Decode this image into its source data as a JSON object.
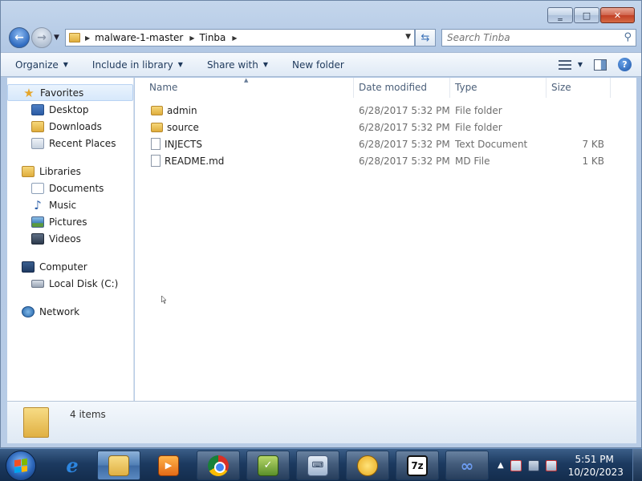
{
  "window": {
    "minimize_glyph": "‗",
    "maximize_glyph": "□",
    "close_glyph": "✕"
  },
  "address": {
    "breadcrumbs": [
      "malware-1-master",
      "Tinba"
    ],
    "back_glyph": "←",
    "forward_glyph": "→"
  },
  "search": {
    "placeholder": "Search Tinba"
  },
  "toolbar": {
    "organize": "Organize",
    "include_in_library": "Include in library",
    "share_with": "Share with",
    "new_folder": "New folder"
  },
  "sidebar": {
    "favorites": {
      "label": "Favorites",
      "items": [
        {
          "label": "Desktop",
          "icon": "desktop-icon"
        },
        {
          "label": "Downloads",
          "icon": "downloads-icon"
        },
        {
          "label": "Recent Places",
          "icon": "recent-places-icon"
        }
      ]
    },
    "libraries": {
      "label": "Libraries",
      "items": [
        {
          "label": "Documents",
          "icon": "documents-icon"
        },
        {
          "label": "Music",
          "icon": "music-icon"
        },
        {
          "label": "Pictures",
          "icon": "pictures-icon"
        },
        {
          "label": "Videos",
          "icon": "videos-icon"
        }
      ]
    },
    "computer": {
      "label": "Computer",
      "items": [
        {
          "label": "Local Disk (C:)",
          "icon": "local-disk-icon"
        }
      ]
    },
    "network": {
      "label": "Network"
    }
  },
  "columns": {
    "name": "Name",
    "date_modified": "Date modified",
    "type": "Type",
    "size": "Size"
  },
  "files": [
    {
      "name": "admin",
      "date": "6/28/2017 5:32 PM",
      "type": "File folder",
      "size": "",
      "icon": "folder-icon"
    },
    {
      "name": "source",
      "date": "6/28/2017 5:32 PM",
      "type": "File folder",
      "size": "",
      "icon": "folder-icon"
    },
    {
      "name": "INJECTS",
      "date": "6/28/2017 5:32 PM",
      "type": "Text Document",
      "size": "7 KB",
      "icon": "text-file-icon"
    },
    {
      "name": "README.md",
      "date": "6/28/2017 5:32 PM",
      "type": "MD File",
      "size": "1 KB",
      "icon": "file-icon"
    }
  ],
  "status": {
    "item_count": "4 items"
  },
  "taskbar": {
    "clock_time": "5:51 PM",
    "clock_date": "10/20/2023",
    "seven_zip_label": "7z",
    "ie_glyph": "e",
    "loop_glyph": "∞"
  },
  "colors": {
    "taskbar": "#1c3a60",
    "accent": "#2f6bc0",
    "selected_nav": "#d7e8fb"
  }
}
